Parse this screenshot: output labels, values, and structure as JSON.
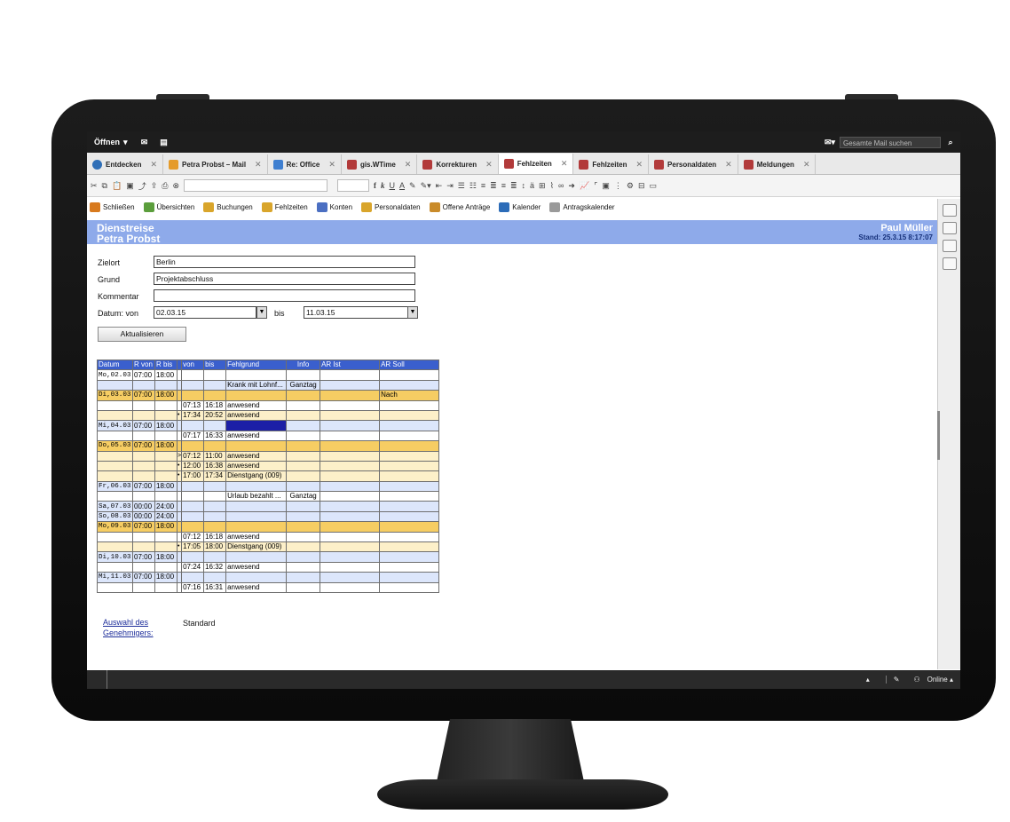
{
  "topbar": {
    "open_label": "Öffnen",
    "search_placeholder": "Gesamte Mail suchen"
  },
  "tabs": [
    {
      "label": "Entdecken",
      "icon": "info-icon"
    },
    {
      "label": "Petra Probst   – Mail",
      "icon": "mail-icon"
    },
    {
      "label": "Re: Office",
      "icon": "reply-icon"
    },
    {
      "label": "gis.WTime",
      "icon": "app-icon"
    },
    {
      "label": "Korrekturen",
      "icon": "app-icon"
    },
    {
      "label": "Fehlzeiten",
      "icon": "app-icon",
      "active": true
    },
    {
      "label": "Fehlzeiten",
      "icon": "app-icon"
    },
    {
      "label": "Personaldaten",
      "icon": "app-icon"
    },
    {
      "label": "Meldungen",
      "icon": "app-icon"
    }
  ],
  "actions": [
    {
      "label": "Schließen",
      "icon": "close-doc-icon"
    },
    {
      "label": "Übersichten",
      "icon": "overview-icon"
    },
    {
      "label": "Buchungen",
      "icon": "bookings-icon"
    },
    {
      "label": "Fehlzeiten",
      "icon": "absence-icon"
    },
    {
      "label": "Konten",
      "icon": "accounts-icon"
    },
    {
      "label": "Personaldaten",
      "icon": "personal-icon"
    },
    {
      "label": "Offene Anträge",
      "icon": "requests-icon"
    },
    {
      "label": "Kalender",
      "icon": "calendar-icon"
    },
    {
      "label": "Antragskalender",
      "icon": "request-calendar-icon"
    }
  ],
  "header": {
    "title": "Dienstreise",
    "person": "Petra Probst",
    "user": "Paul Müller",
    "stand": "Stand: 25.3.15 8:17:07"
  },
  "form": {
    "zielort_label": "Zielort",
    "zielort_value": "Berlin",
    "grund_label": "Grund",
    "grund_value": "Projektabschluss",
    "kommentar_label": "Kommentar",
    "kommentar_value": "",
    "datum_label": "Datum:  von",
    "von_value": "02.03.15",
    "bis_label": "bis",
    "bis_value": "11.03.15",
    "update_button": "Aktualisieren"
  },
  "table": {
    "columns": [
      "Datum",
      "R von",
      "R bis",
      "",
      "von",
      "bis",
      "Fehlgrund",
      "Info",
      "AR Ist",
      "AR Soll"
    ],
    "rows": [
      {
        "style": "white",
        "cells": [
          "Mo,02.03",
          "07:00",
          "18:00",
          "",
          "",
          "",
          "",
          "",
          "",
          ""
        ]
      },
      {
        "style": "blue",
        "cells": [
          "",
          "",
          "",
          "",
          "",
          "",
          "Krank mit Lohnf...",
          "Ganztag",
          "",
          ""
        ]
      },
      {
        "style": "orange",
        "cells": [
          "Di,03.03",
          "07:00",
          "18:00",
          "",
          "",
          "",
          "",
          "",
          "",
          "Nach"
        ]
      },
      {
        "style": "white",
        "cells": [
          "",
          "",
          "",
          "",
          "07:13",
          "16:18",
          "anwesend",
          "",
          "",
          ""
        ]
      },
      {
        "style": "light",
        "cells": [
          "",
          "",
          "",
          "•",
          "17:34",
          "20:52",
          "anwesend",
          "",
          "",
          ""
        ]
      },
      {
        "style": "blue",
        "cells": [
          "Mi,04.03",
          "07:00",
          "18:00",
          "",
          "",
          "",
          "",
          "",
          "",
          ""
        ],
        "selected": 6
      },
      {
        "style": "white",
        "cells": [
          "",
          "",
          "",
          "",
          "07:17",
          "16:33",
          "anwesend",
          "",
          "",
          ""
        ]
      },
      {
        "style": "orange",
        "cells": [
          "Do,05.03",
          "07:00",
          "18:00",
          "",
          "",
          "",
          "",
          "",
          "",
          ""
        ]
      },
      {
        "style": "light",
        "cells": [
          "",
          "",
          "",
          ">",
          "07:12",
          "11:00",
          "anwesend",
          "",
          "",
          ""
        ]
      },
      {
        "style": "light",
        "cells": [
          "",
          "",
          "",
          "•",
          "12:00",
          "16:38",
          "anwesend",
          "",
          "",
          ""
        ]
      },
      {
        "style": "light",
        "cells": [
          "",
          "",
          "",
          "•",
          "17:00",
          "17:34",
          "Dienstgang (009)",
          "",
          "",
          ""
        ]
      },
      {
        "style": "blue",
        "cells": [
          "Fr,06.03",
          "07:00",
          "18:00",
          "",
          "",
          "",
          "",
          "",
          "",
          ""
        ]
      },
      {
        "style": "white",
        "cells": [
          "",
          "",
          "",
          "",
          "",
          "",
          "Urlaub bezahlt ...",
          "Ganztag",
          "",
          ""
        ]
      },
      {
        "style": "blue",
        "cells": [
          "Sa,07.03",
          "00:00",
          "24:00",
          "",
          "",
          "",
          "",
          "",
          "",
          ""
        ]
      },
      {
        "style": "blue",
        "cells": [
          "So,08.03",
          "00:00",
          "24:00",
          "",
          "",
          "",
          "",
          "",
          "",
          ""
        ]
      },
      {
        "style": "orange",
        "cells": [
          "Mo,09.03",
          "07:00",
          "18:00",
          "",
          "",
          "",
          "",
          "",
          "",
          ""
        ]
      },
      {
        "style": "white",
        "cells": [
          "",
          "",
          "",
          "",
          "07:12",
          "16:18",
          "anwesend",
          "",
          "",
          ""
        ]
      },
      {
        "style": "light",
        "cells": [
          "",
          "",
          "",
          "•",
          "17:05",
          "18:00",
          "Dienstgang (009)",
          "",
          "",
          ""
        ]
      },
      {
        "style": "blue",
        "cells": [
          "Di,10.03",
          "07:00",
          "18:00",
          "",
          "",
          "",
          "",
          "",
          "",
          ""
        ]
      },
      {
        "style": "white",
        "cells": [
          "",
          "",
          "",
          "",
          "07:24",
          "16:32",
          "anwesend",
          "",
          "",
          ""
        ]
      },
      {
        "style": "blue",
        "cells": [
          "Mi,11.03",
          "07:00",
          "18:00",
          "",
          "",
          "",
          "",
          "",
          "",
          ""
        ]
      },
      {
        "style": "white",
        "cells": [
          "",
          "",
          "",
          "",
          "07:16",
          "16:31",
          "anwesend",
          "",
          "",
          ""
        ]
      }
    ]
  },
  "approver": {
    "link_line1": "Auswahl des",
    "link_line2": "Genehmigers:",
    "value": "Standard"
  },
  "status": {
    "online": "Online"
  },
  "colors": {
    "header_band": "#8eaaea",
    "table_header": "#3a5fcd",
    "row_blue": "#dce6fb",
    "row_orange": "#f6cd63",
    "row_light": "#fdf0c9"
  }
}
